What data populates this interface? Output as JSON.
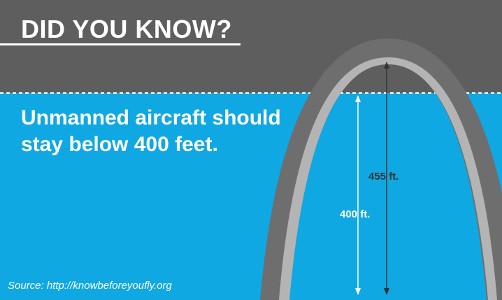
{
  "headline": "DID YOU KNOW?",
  "statement": "Unmanned aircraft should stay below 400 feet.",
  "measurements": {
    "arch_height": "455 ft.",
    "altitude_limit": "400 ft."
  },
  "source": "Source: http://knowbeforeyoufly.org",
  "colors": {
    "sky_band": "#5e5e5e",
    "airspace": "#10a8e2",
    "arch_outer": "#6e6e6e",
    "arch_inner": "#b4b4b4",
    "text": "#ffffff"
  },
  "icons": [
    "arch-icon",
    "arrow-icon"
  ]
}
